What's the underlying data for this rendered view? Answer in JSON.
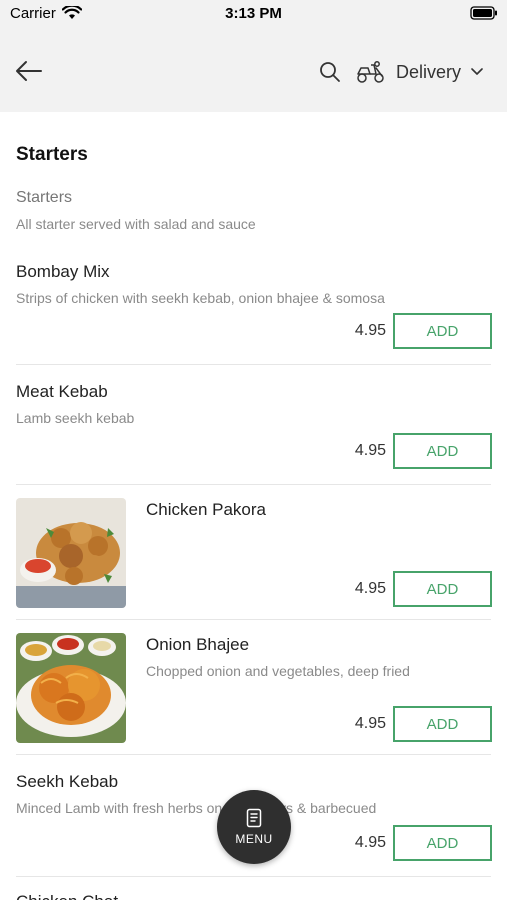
{
  "status_bar": {
    "carrier": "Carrier",
    "time": "3:13 PM"
  },
  "header": {
    "delivery_label": "Delivery"
  },
  "section": {
    "title": "Starters",
    "category_name": "Starters",
    "category_description": "All starter served with salad and sauce"
  },
  "items": [
    {
      "name": "Bombay Mix",
      "description": "Strips of chicken with seekh kebab, onion bhajee & somosa",
      "price": "4.95",
      "add_label": "ADD"
    },
    {
      "name": "Meat Kebab",
      "description": "Lamb seekh kebab",
      "price": "4.95",
      "add_label": "ADD"
    },
    {
      "name": "Chicken Pakora",
      "description": "",
      "price": "4.95",
      "add_label": "ADD"
    },
    {
      "name": "Onion Bhajee",
      "description": "Chopped onion and vegetables, deep fried",
      "price": "4.95",
      "add_label": "ADD"
    },
    {
      "name": "Seekh Kebab",
      "description": "Minced Lamb with fresh herbs on to skewers & barbecued",
      "price": "4.95",
      "add_label": "ADD"
    },
    {
      "name": "Chicken Chat",
      "description": "",
      "price": "",
      "add_label": ""
    }
  ],
  "menu_button": {
    "label": "MENU"
  },
  "colors": {
    "accent": "#47a36a",
    "header_bg": "#f2f2f2",
    "fab_bg": "#2f2f2f"
  }
}
